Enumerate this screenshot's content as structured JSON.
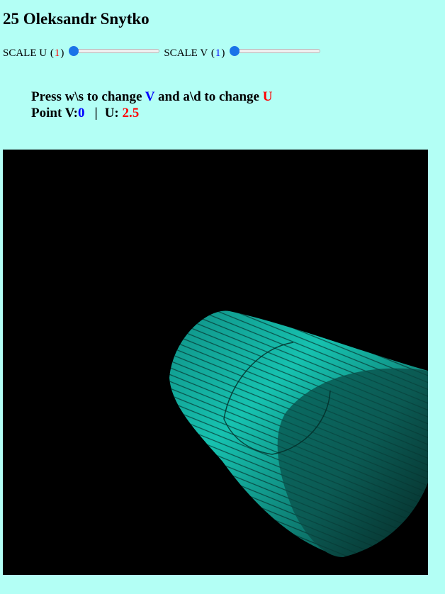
{
  "title": "25 Oleksandr Snytko",
  "scale_u": {
    "label": "SCALE U",
    "value": "1",
    "slider_fraction": 0.0
  },
  "scale_v": {
    "label": "SCALE V",
    "value": "1",
    "slider_fraction": 0.0
  },
  "info": {
    "line1_a": "Press w\\s to change ",
    "line1_v": "V",
    "line1_b": " and a\\d to change ",
    "line1_u": "U",
    "point_v_label": "Point V:",
    "point_v_value": "0",
    "separator": "|",
    "u_label": "U:",
    "u_value": "2.5"
  },
  "colors": {
    "background": "#b3fff5",
    "canvas": "#000000",
    "surface": "#13b3a3",
    "accent_blue": "#0000ff",
    "accent_red": "#ff0000"
  }
}
